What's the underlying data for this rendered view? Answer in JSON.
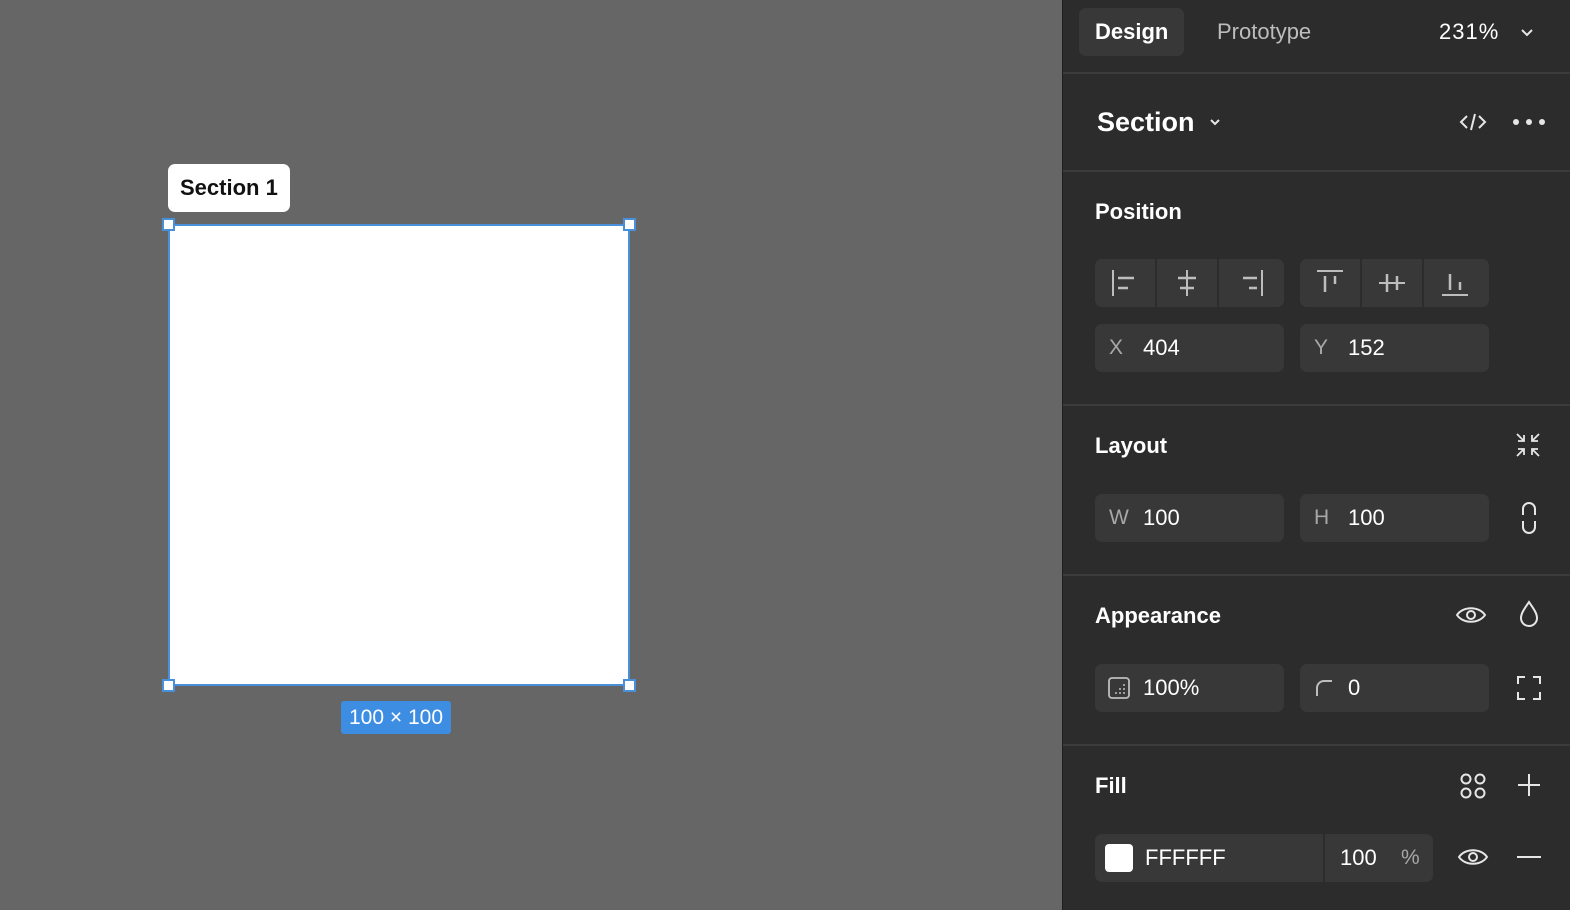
{
  "canvas": {
    "section_label": "Section 1",
    "size_badge": "100 × 100"
  },
  "panel": {
    "tabs": [
      {
        "label": "Design",
        "active": true
      },
      {
        "label": "Prototype",
        "active": false
      }
    ],
    "zoom": "231%",
    "header": {
      "title": "Section"
    },
    "position": {
      "title": "Position",
      "x_label": "X",
      "x_value": "404",
      "y_label": "Y",
      "y_value": "152"
    },
    "layout": {
      "title": "Layout",
      "w_label": "W",
      "w_value": "100",
      "h_label": "H",
      "h_value": "100"
    },
    "appearance": {
      "title": "Appearance",
      "opacity": "100%",
      "corner_radius": "0"
    },
    "fill": {
      "title": "Fill",
      "hex": "FFFFFF",
      "opacity": "100",
      "percent": "%",
      "swatch_color": "#FFFFFF"
    }
  },
  "colors": {
    "canvas_bg": "#666666",
    "panel_bg": "#2C2C2C",
    "selection_blue": "#4A90D9",
    "badge_blue": "#3D8DE3"
  }
}
